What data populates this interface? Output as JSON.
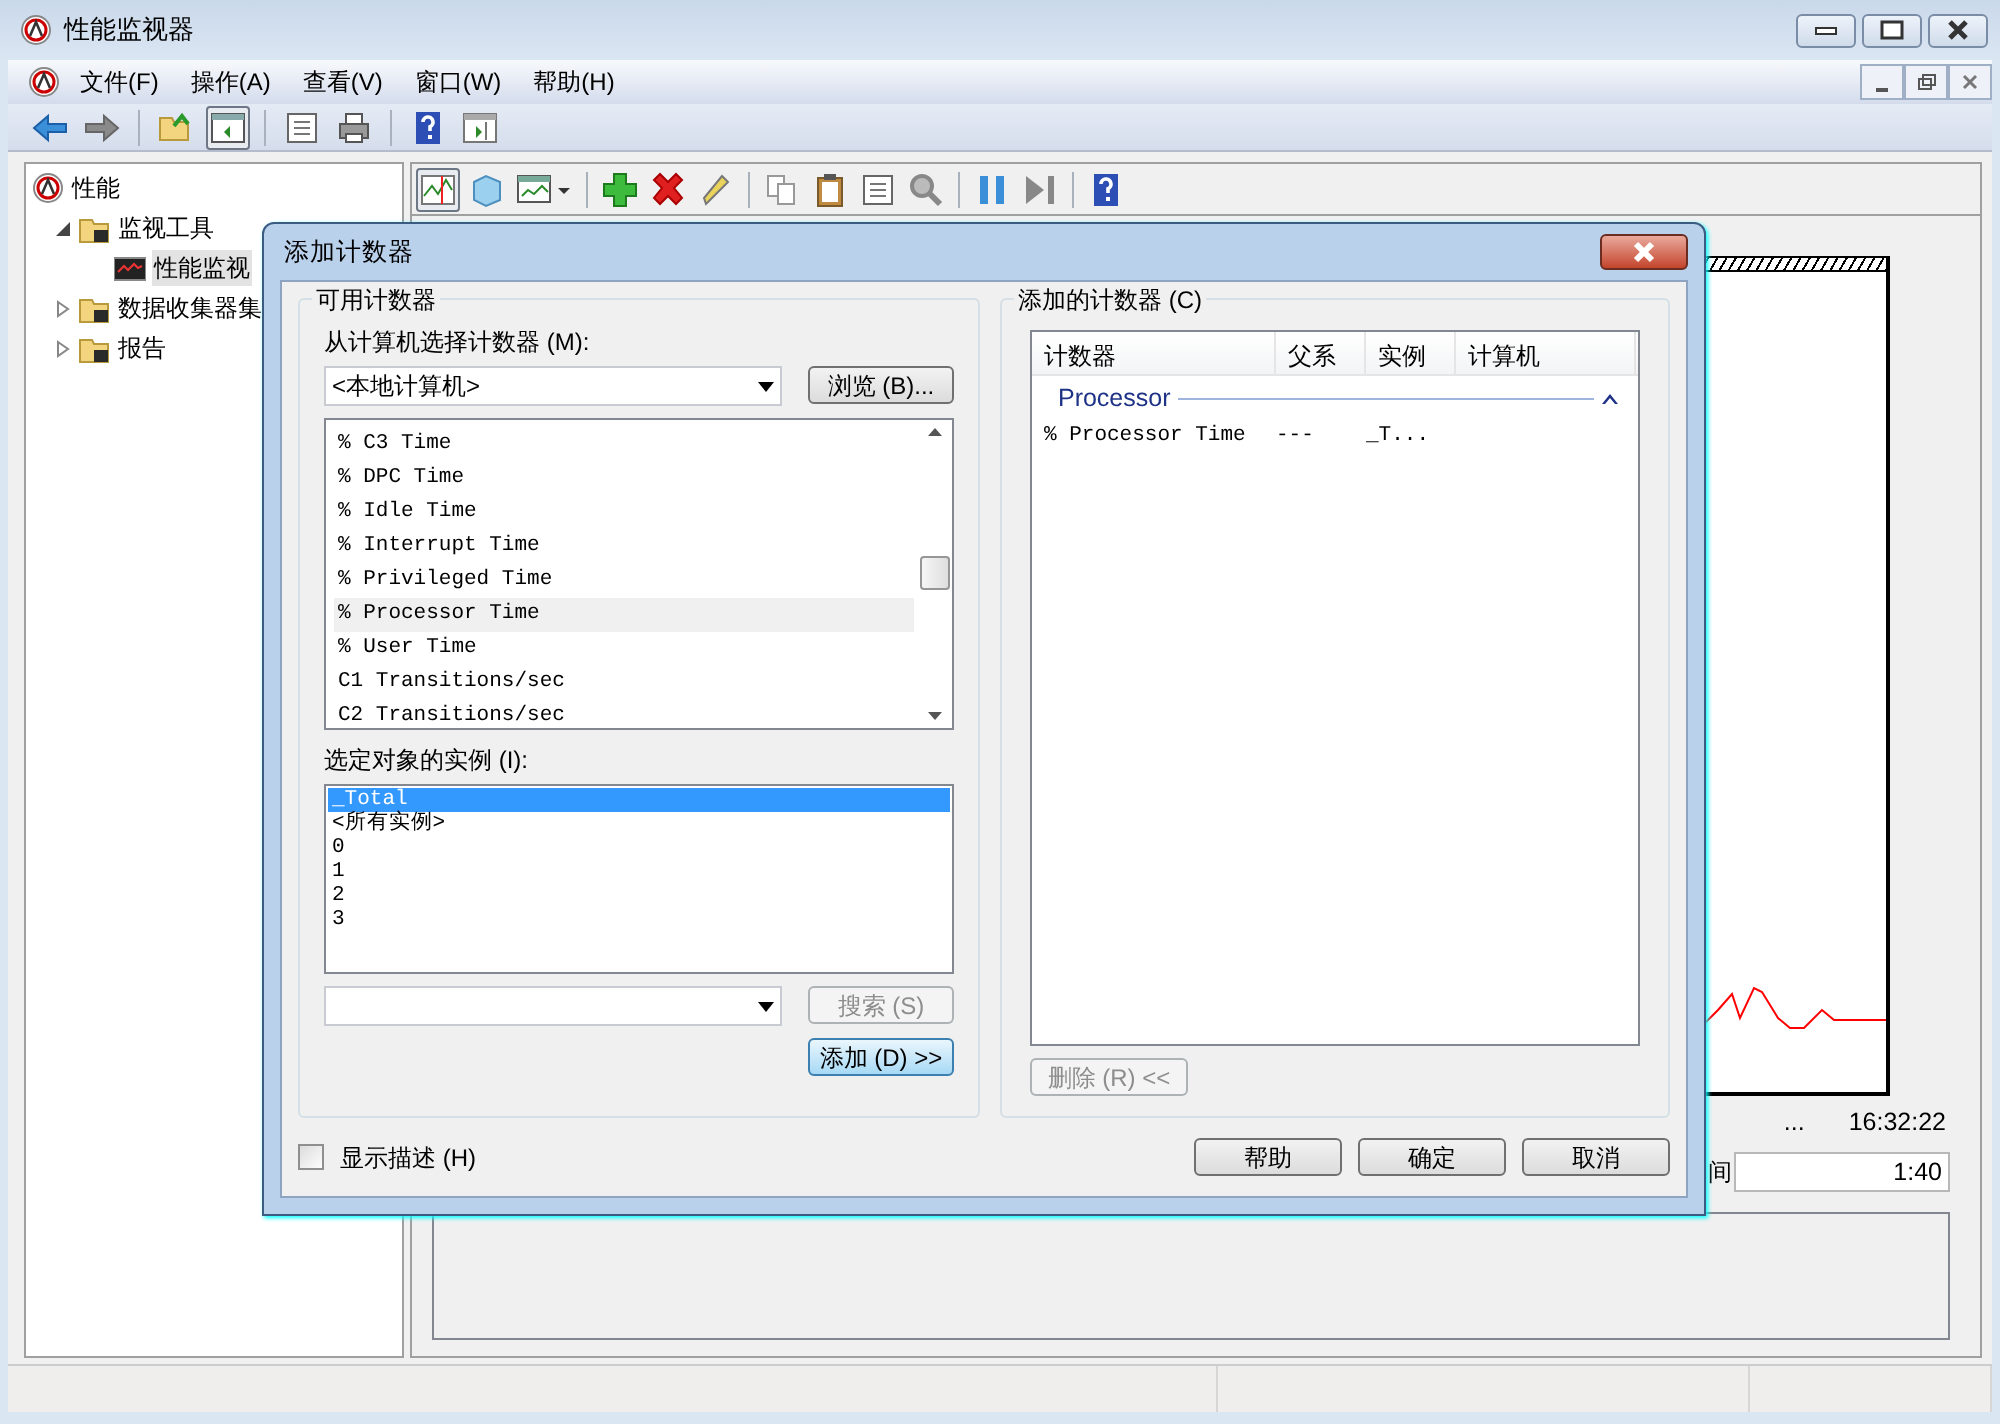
{
  "window": {
    "title": "性能监视器"
  },
  "menu": [
    {
      "label": "文件(F)"
    },
    {
      "label": "操作(A)"
    },
    {
      "label": "查看(V)"
    },
    {
      "label": "窗口(W)"
    },
    {
      "label": "帮助(H)"
    }
  ],
  "tree": [
    {
      "label": "性能",
      "kind": "root",
      "selected": false,
      "children": [
        {
          "label": "监视工具",
          "kind": "folder",
          "selected": false,
          "expanded": true,
          "children": [
            {
              "label": "性能监视",
              "kind": "monitor",
              "selected": true
            }
          ]
        },
        {
          "label": "数据收集器集",
          "kind": "folder",
          "selected": false,
          "expanded": false
        },
        {
          "label": "报告",
          "kind": "folder",
          "selected": false,
          "expanded": false
        }
      ]
    }
  ],
  "graph": {
    "time_labels": [
      "...",
      "16:32:22"
    ],
    "duration_label": "间",
    "duration_value": "1:40"
  },
  "dialog": {
    "title": "添加计数器",
    "available": {
      "legend": "可用计数器",
      "computer_label": "从计算机选择计数器 (M):",
      "computer_value": "<本地计算机>",
      "browse_button": "浏览 (B)...",
      "counters": [
        {
          "label": "% C3 Time",
          "selected": false
        },
        {
          "label": "% DPC Time",
          "selected": false
        },
        {
          "label": "% Idle Time",
          "selected": false
        },
        {
          "label": "% Interrupt Time",
          "selected": false
        },
        {
          "label": "% Privileged Time",
          "selected": false
        },
        {
          "label": "% Processor Time",
          "selected": true
        },
        {
          "label": "% User Time",
          "selected": false
        },
        {
          "label": "C1 Transitions/sec",
          "selected": false
        },
        {
          "label": "C2 Transitions/sec",
          "selected": false
        }
      ],
      "instances_label": "选定对象的实例 (I):",
      "instances": [
        {
          "label": "_Total",
          "selected": true
        },
        {
          "label": "<所有实例>",
          "selected": false
        },
        {
          "label": "0",
          "selected": false
        },
        {
          "label": "1",
          "selected": false
        },
        {
          "label": "2",
          "selected": false
        },
        {
          "label": "3",
          "selected": false
        }
      ],
      "search_button": {
        "label": "搜索 (S)",
        "disabled": true
      },
      "add_button": {
        "label": "添加 (D) >>",
        "disabled": false
      }
    },
    "added": {
      "legend": "添加的计数器 (C)",
      "columns": [
        "计数器",
        "父系",
        "实例",
        "计算机"
      ],
      "groups": [
        {
          "name": "Processor",
          "expanded": true,
          "rows": [
            {
              "counter": "% Processor Time",
              "parent": "---",
              "instance": "_T..."
            }
          ]
        }
      ],
      "remove_button": {
        "label": "删除 (R) <<",
        "disabled": true
      }
    },
    "show_description": {
      "label": "显示描述 (H)",
      "checked": false
    },
    "buttons": [
      "帮助",
      "确定",
      "取消"
    ]
  }
}
